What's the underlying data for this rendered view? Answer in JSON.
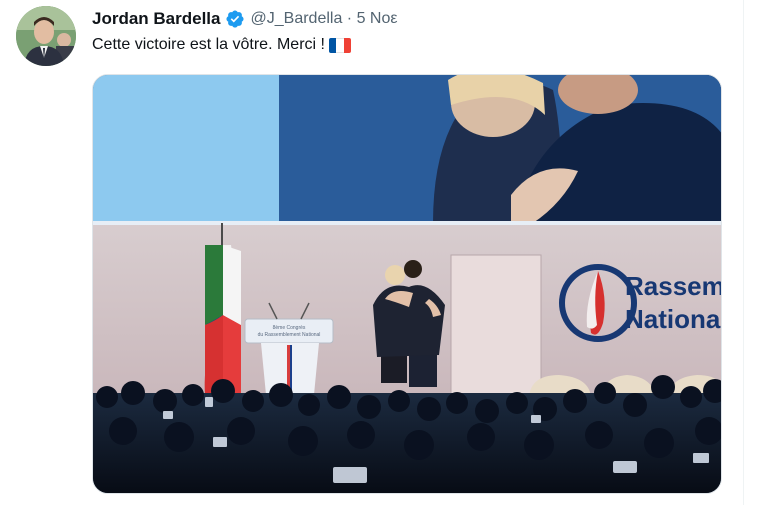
{
  "tweet": {
    "author_name": "Jordan Bardella",
    "handle_and_date": "@J_Bardella · 5 Νοε",
    "text": "Cette victoire est la vôtre. Merci !",
    "flag_icon": "french-flag-emoji",
    "verified_icon": "verified-badge-icon"
  },
  "media": {
    "podium_text_1": "8ème Congrès",
    "podium_text_2": "du Rassemblement National",
    "logo_text_1": "Rassem",
    "logo_text_2": "Nationa"
  },
  "colors": {
    "verified": "#1d9bf0",
    "flag_blue": "#0055a4",
    "flag_white": "#ffffff",
    "flag_red": "#ef4135"
  }
}
